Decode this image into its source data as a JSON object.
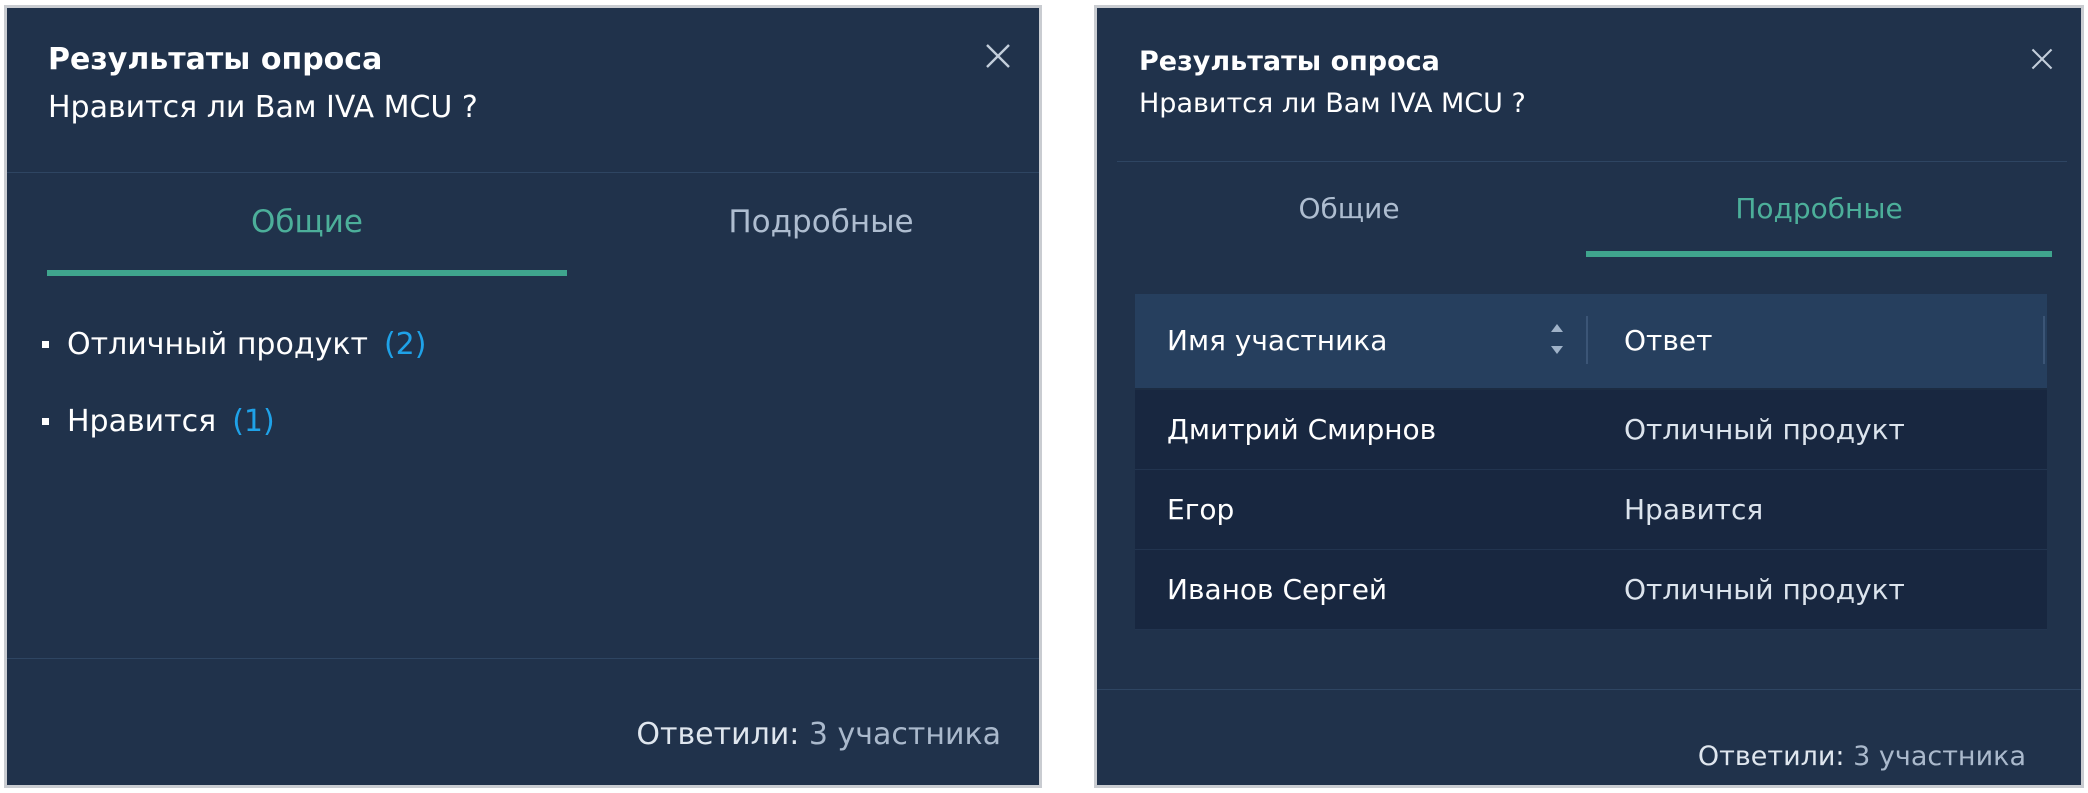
{
  "left_panel": {
    "title": "Результаты опроса",
    "question": "Нравится ли Вам IVA MCU ?",
    "tabs": [
      {
        "label": "Общие",
        "active": true
      },
      {
        "label": "Подробные",
        "active": false
      }
    ],
    "results": [
      {
        "label": "Отличный продукт",
        "count": "(2)"
      },
      {
        "label": "Нравится",
        "count": "(1)"
      }
    ],
    "footer": {
      "label": "Ответили:",
      "value": "3 участника"
    }
  },
  "right_panel": {
    "title": "Результаты опроса",
    "question": "Нравится ли Вам IVA MCU ?",
    "tabs": [
      {
        "label": "Общие",
        "active": false
      },
      {
        "label": "Подробные",
        "active": true
      }
    ],
    "table": {
      "columns": [
        "Имя участника",
        "Ответ"
      ],
      "rows": [
        {
          "name": "Дмитрий Смирнов",
          "answer": "Отличный продукт"
        },
        {
          "name": "Егор",
          "answer": "Нравится"
        },
        {
          "name": "Иванов Сергей",
          "answer": "Отличный продукт"
        }
      ]
    },
    "footer": {
      "label": "Ответили:",
      "value": "3 участника"
    }
  },
  "icons": {
    "close": "close-icon",
    "sort": "sort-icon"
  },
  "colors": {
    "panel_bg": "#20324b",
    "accent": "#4caf9a",
    "count": "#1fa2e8"
  }
}
